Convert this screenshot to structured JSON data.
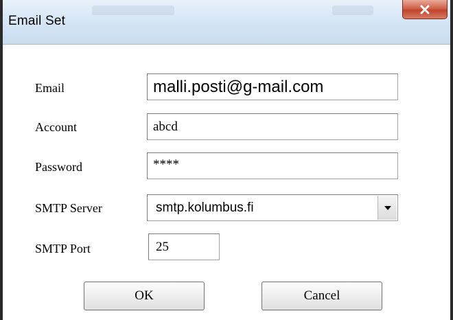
{
  "window": {
    "title": "Email Set"
  },
  "icons": {
    "close": "close-icon",
    "dropdown": "chevron-down-icon"
  },
  "form": {
    "email": {
      "label": "Email",
      "value": "malli.posti@g-mail.com"
    },
    "account": {
      "label": "Account",
      "value": "abcd"
    },
    "password": {
      "label": "Password",
      "value": "****"
    },
    "smtp_server": {
      "label": "SMTP Server",
      "value": "smtp.kolumbus.fi"
    },
    "smtp_port": {
      "label": "SMTP Port",
      "value": "25"
    }
  },
  "buttons": {
    "ok_label": "OK",
    "cancel_label": "Cancel"
  },
  "colors": {
    "titlebar": "#d6e6f5",
    "close_button": "#c0452c",
    "window_background": "#ffffff"
  }
}
